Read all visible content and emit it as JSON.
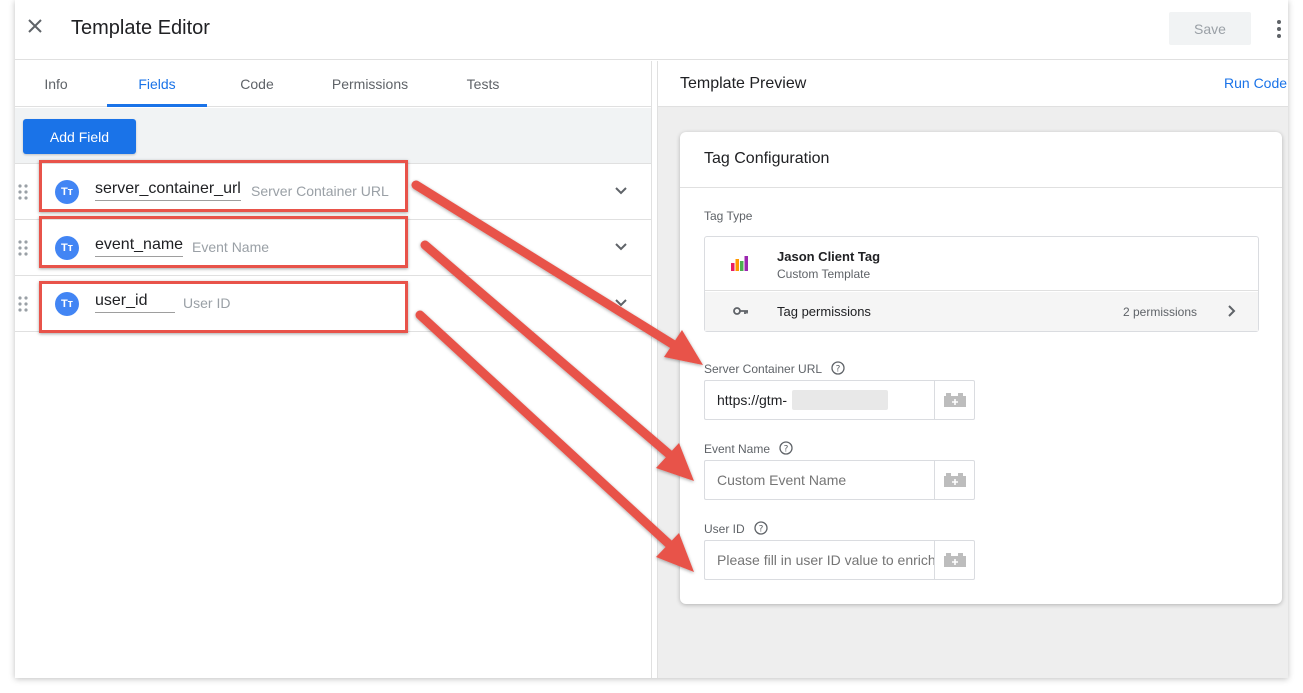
{
  "header": {
    "title": "Template Editor",
    "save_label": "Save"
  },
  "tabs": [
    {
      "label": "Info"
    },
    {
      "label": "Fields"
    },
    {
      "label": "Code"
    },
    {
      "label": "Permissions"
    },
    {
      "label": "Tests"
    }
  ],
  "active_tab": "Fields",
  "toolbar": {
    "add_field_label": "Add Field"
  },
  "fields": [
    {
      "name": "server_container_url",
      "display_name": "Server Container URL",
      "type_icon": "Tт"
    },
    {
      "name": "event_name",
      "display_name": "Event Name",
      "type_icon": "Tт"
    },
    {
      "name": "user_id",
      "display_name": "User ID",
      "type_icon": "Tт"
    }
  ],
  "preview": {
    "title": "Template Preview",
    "run_code_label": "Run Code",
    "card_title": "Tag Configuration",
    "tag_type_label": "Tag Type",
    "tag_name": "Jason Client Tag",
    "tag_subtitle": "Custom Template",
    "permissions_label": "Tag permissions",
    "permissions_count": "2 permissions",
    "params": [
      {
        "label": "Server Container URL",
        "value": "https://gtm-              .uc.r.a",
        "placeholder": ""
      },
      {
        "label": "Event Name",
        "value": "",
        "placeholder": "Custom Event Name"
      },
      {
        "label": "User ID",
        "value": "",
        "placeholder": "Please fill in user ID value to enrich"
      }
    ]
  },
  "colors": {
    "accent": "#1a73e8",
    "highlight": "#e8534a",
    "field_icon": "#4285f4"
  },
  "icons": {
    "close": "close-icon",
    "more": "more-vert-icon",
    "drag": "drag-handle-icon",
    "chevron": "chevron-down-icon",
    "tag": "bar-chart-icon",
    "key": "key-icon",
    "chevron_right": "chevron-right-icon",
    "help": "help-icon",
    "variable": "variable-picker-icon"
  }
}
